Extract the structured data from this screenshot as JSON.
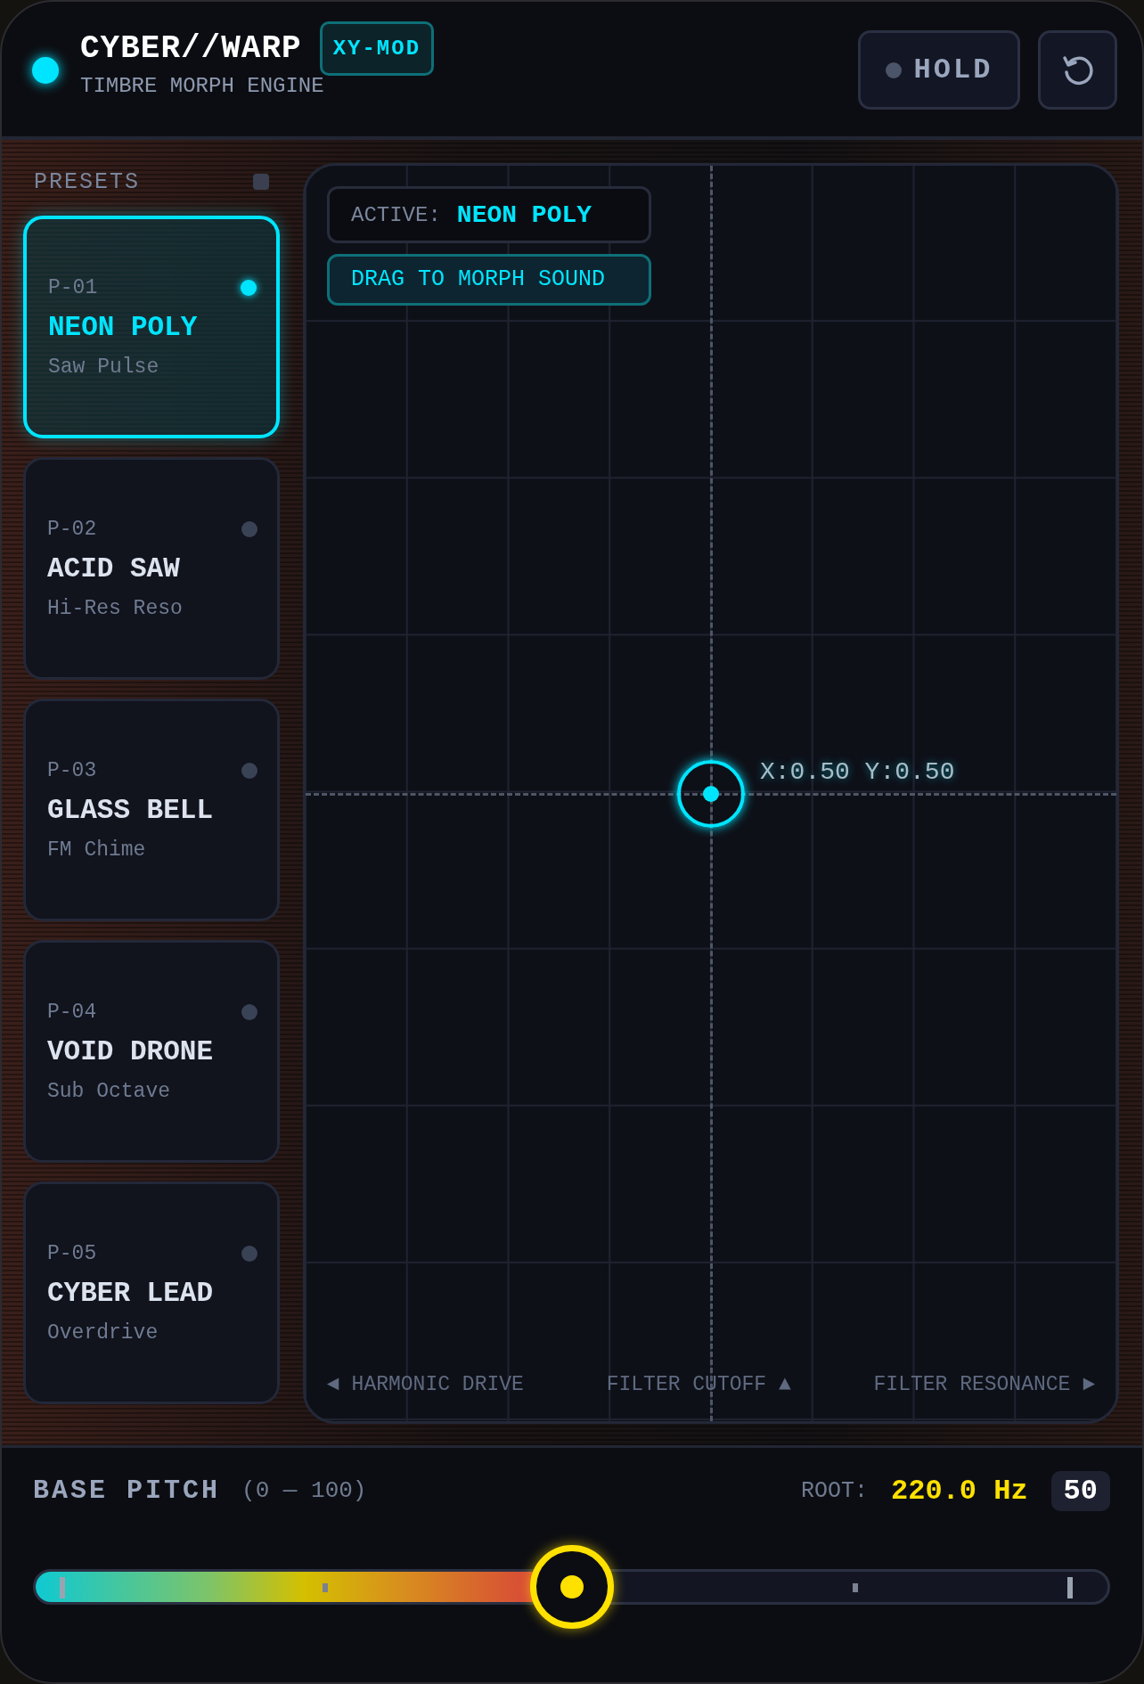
{
  "header": {
    "status_on": true,
    "title": "CYBER//WARP",
    "badge": "XY-MOD",
    "subtitle": "TIMBRE MORPH ENGINE",
    "hold": {
      "label": "HOLD",
      "on": false
    }
  },
  "presets": {
    "title": "PRESETS",
    "items": [
      {
        "code": "P-01",
        "name": "NEON POLY",
        "sub": "Saw Pulse",
        "selected": true
      },
      {
        "code": "P-02",
        "name": "ACID SAW",
        "sub": "Hi-Res Reso",
        "selected": false
      },
      {
        "code": "P-03",
        "name": "GLASS BELL",
        "sub": "FM Chime",
        "selected": false
      },
      {
        "code": "P-04",
        "name": "VOID DRONE",
        "sub": "Sub Octave",
        "selected": false
      },
      {
        "code": "P-05",
        "name": "CYBER LEAD",
        "sub": "Overdrive",
        "selected": false
      }
    ]
  },
  "pad": {
    "active_label": "ACTIVE:",
    "active_value": "NEON POLY",
    "hint": "DRAG TO MORPH SOUND",
    "readout": "X:0.50 Y:0.50",
    "axis_labels": [
      "◄ HARMONIC DRIVE",
      "FILTER CUTOFF ▲",
      "FILTER RESONANCE ►"
    ]
  },
  "pitch": {
    "title": "BASE PITCH",
    "range": "(0 — 100)",
    "root_label": "ROOT:",
    "root_value": "220.0 Hz",
    "value": "50",
    "level": 0.5
  }
}
